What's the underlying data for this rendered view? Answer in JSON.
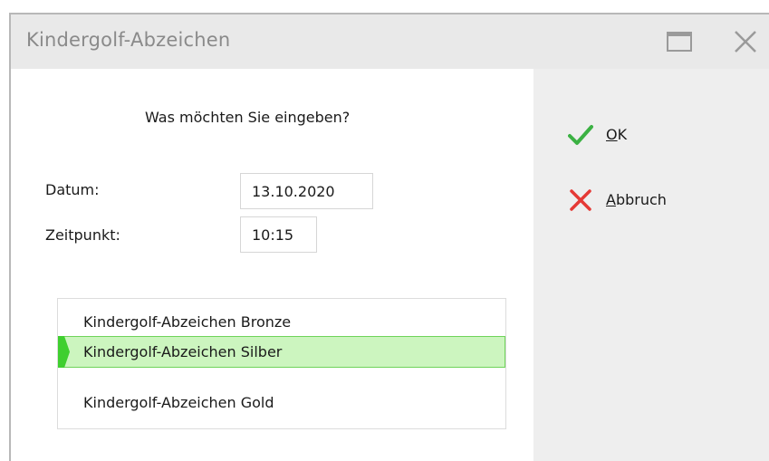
{
  "window": {
    "title": "Kindergolf-Abzeichen"
  },
  "form": {
    "prompt": "Was möchten Sie eingeben?",
    "datum_label": "Datum:",
    "datum_value": "13.10.2020",
    "zeitpunkt_label": "Zeitpunkt:",
    "zeitpunkt_value": "10:15"
  },
  "badges": {
    "items": [
      {
        "label": "Kindergolf-Abzeichen Bronze",
        "selected": false
      },
      {
        "label": "Kindergolf-Abzeichen Silber",
        "selected": true
      },
      {
        "label": "Kindergolf-Abzeichen Gold",
        "selected": false
      }
    ]
  },
  "actions": {
    "ok": {
      "mnemonic": "O",
      "rest": "K",
      "icon": "checkmark-icon",
      "color": "#3bb143"
    },
    "cancel": {
      "mnemonic": "A",
      "rest": "bbruch",
      "icon": "cross-icon",
      "color": "#e53935"
    }
  },
  "colors": {
    "selection_bg": "#ccf5bf",
    "selection_border": "#6fd45a",
    "selection_marker": "#3fcf2f"
  }
}
